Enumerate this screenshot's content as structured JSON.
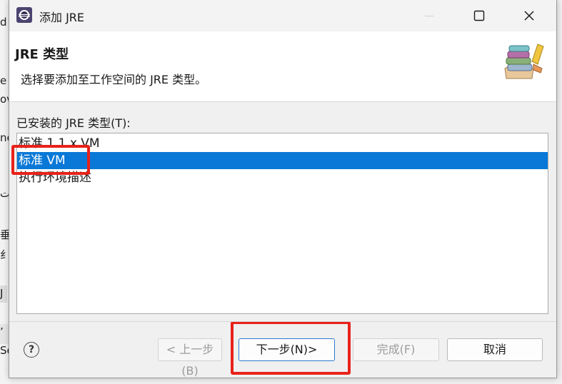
{
  "background_fragments": [
    "d",
    "e",
    "ov",
    "ne",
    "ت",
    "垂",
    "纟",
    "J",
    "’",
    "Se"
  ],
  "window": {
    "title": "添加 JRE",
    "controls": {
      "minimize": "minimize",
      "maximize": "maximize",
      "close": "close"
    }
  },
  "banner": {
    "title": "JRE 类型",
    "description": "选择要添加至工作空间的 JRE 类型。",
    "icon": "library-books-icon"
  },
  "list": {
    "label": "已安装的 JRE 类型(T):",
    "items": [
      {
        "label": "标准 1.1.x VM",
        "selected": false
      },
      {
        "label": "标准 VM",
        "selected": true
      },
      {
        "label": "执行环境描述",
        "selected": false
      }
    ]
  },
  "buttons": {
    "help": "?",
    "back": "< 上一步(B)",
    "next": "下一步(N)>",
    "finish": "完成(F)",
    "cancel": "取消"
  },
  "colors": {
    "selection": "#0a78d7",
    "annotation": "#e8221a"
  }
}
